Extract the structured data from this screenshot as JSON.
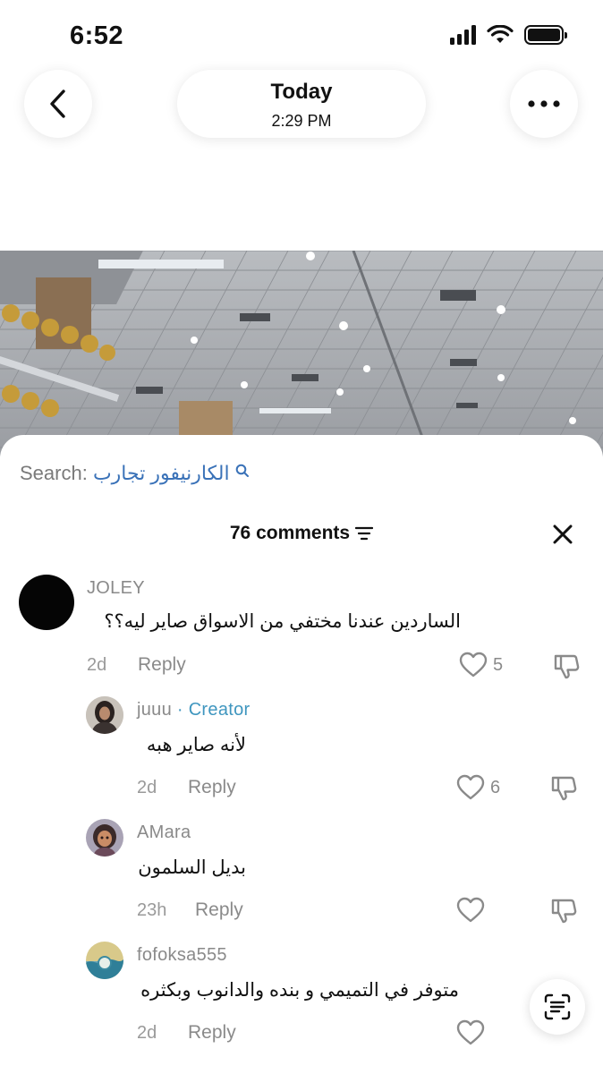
{
  "status": {
    "time": "6:52"
  },
  "header": {
    "title": "Today",
    "subtitle": "2:29 PM"
  },
  "search": {
    "prefix": "Search:",
    "term": "الكارنيفور تجارب"
  },
  "comments_header": {
    "count_label": "76 comments"
  },
  "comments": [
    {
      "username": "JOLEY",
      "creator_label": "",
      "text": "الساردين عندنا مختفي من الاسواق صاير ليه؟؟",
      "time": "2d",
      "reply_label": "Reply",
      "likes": "5"
    },
    {
      "username": "juuu",
      "creator_label": "· Creator",
      "text": "لأنه صاير هبه",
      "time": "2d",
      "reply_label": "Reply",
      "likes": "6"
    },
    {
      "username": "AMara",
      "creator_label": "",
      "text": "بديل السلمون",
      "time": "23h",
      "reply_label": "Reply",
      "likes": ""
    },
    {
      "username": "fofoksa555",
      "creator_label": "",
      "text": "متوفر في التميمي و بنده والدانوب وبكثره",
      "time": "2d",
      "reply_label": "Reply",
      "likes": ""
    }
  ],
  "icons": {
    "back": "chevron-left-icon",
    "more": "more-horizontal-icon",
    "search": "search-icon",
    "filter": "filter-icon",
    "close": "close-icon",
    "like": "heart-icon",
    "dislike": "thumbs-down-icon",
    "scan": "text-scan-icon"
  },
  "colors": {
    "creator": "#3f96bf",
    "search_term": "#3a72b8",
    "muted": "#8a8a8a"
  }
}
